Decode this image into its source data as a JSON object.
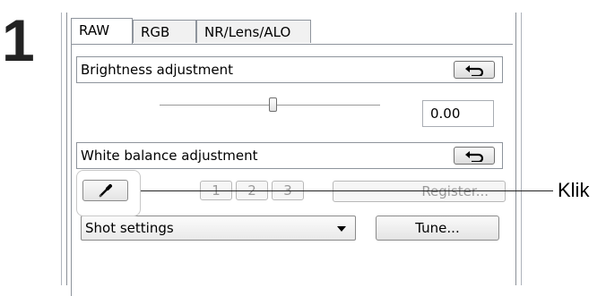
{
  "step_number": "1",
  "tabs": [
    {
      "label": "RAW",
      "active": true
    },
    {
      "label": "RGB",
      "active": false
    },
    {
      "label": "NR/Lens/ALO",
      "active": false
    }
  ],
  "brightness": {
    "title": "Brightness adjustment",
    "value": "0.00",
    "slider_position_fraction": 0.5
  },
  "white_balance": {
    "title": "White balance adjustment",
    "preset_buttons": [
      "1",
      "2",
      "3"
    ],
    "register_label": "Register...",
    "shot_settings_value": "Shot settings",
    "tune_label": "Tune..."
  },
  "callout": {
    "label": "Klik"
  },
  "icons": {
    "reset": "reset-arrow-icon",
    "eyedropper": "eyedropper-icon",
    "dropdown": "chevron-down-icon"
  }
}
